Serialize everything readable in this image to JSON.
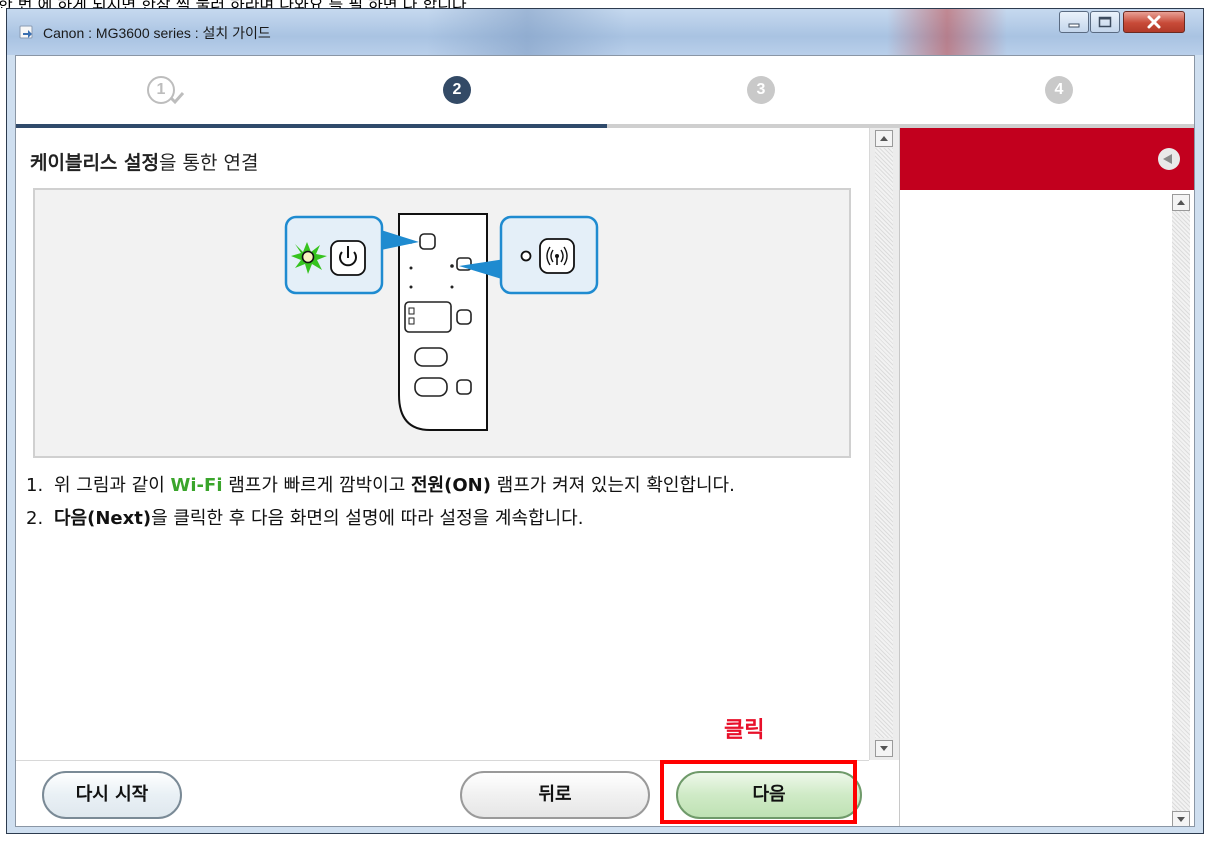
{
  "top_strip_text": "한 번 에 하게 되시면 한참 씩 눌러 하라며 나와요 를 필 하면 다 합니다",
  "window": {
    "title": "Canon : MG3600 series : 설치 가이드"
  },
  "steps": {
    "labels": [
      "1",
      "2",
      "3",
      "4"
    ],
    "current": 2,
    "completed": [
      1
    ]
  },
  "content": {
    "heading_bold": "케이블리스 설정",
    "heading_rest": "을 통한 연결",
    "instructions": {
      "item1": {
        "num": "1.",
        "p1": "위 그림과 같이 ",
        "wifi": "Wi-Fi",
        "p2": " 램프가 빠르게 깜박이고 ",
        "power": "전원(ON)",
        "p3": " 램프가 켜져 있는지 확인합니다."
      },
      "item2": {
        "num": "2.",
        "next": "다음(Next)",
        "rest": "을 클릭한 후 다음 화면의 설명에 따라 설정을 계속합니다."
      }
    }
  },
  "buttons": {
    "restart": "다시 시작",
    "back": "뒤로",
    "next": "다음"
  },
  "annotation": {
    "click_label": "클릭",
    "highlight_color": "#ff0000"
  },
  "colors": {
    "side_header": "#c2001e",
    "step_active": "#334a66",
    "wifi_green": "#3aa52b"
  }
}
